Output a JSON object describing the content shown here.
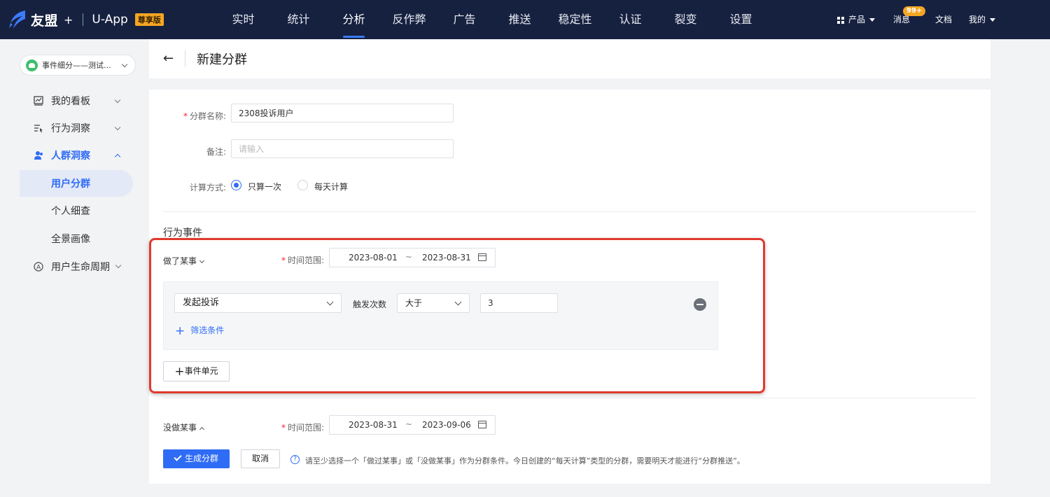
{
  "topbar": {
    "brand_name": "友盟",
    "brand_plus": "+",
    "brand_app": "U-App",
    "brand_badge": "尊享版",
    "nav": [
      "实时",
      "统计",
      "分析",
      "反作弊",
      "广告",
      "推送",
      "稳定性",
      "认证",
      "裂变",
      "设置"
    ],
    "nav_active_index": 2,
    "products_label": "产品",
    "messages_label": "消息",
    "messages_badge": "99+",
    "docs_label": "文档",
    "me_label": "我的"
  },
  "sidebar": {
    "app_name": "事件细分——测试...",
    "items": [
      {
        "label": "我的看板",
        "icon": "dashboard-icon"
      },
      {
        "label": "行为洞察",
        "icon": "behavior-icon"
      },
      {
        "label": "人群洞察",
        "icon": "people-icon"
      },
      {
        "label": "用户分群"
      },
      {
        "label": "个人细查"
      },
      {
        "label": "全景画像"
      },
      {
        "label": "用户生命周期",
        "icon": "lifecycle-icon"
      }
    ]
  },
  "header": {
    "title": "新建分群"
  },
  "form": {
    "name_label": "分群名称:",
    "name_value": "2308投诉用户",
    "note_label": "备注:",
    "note_placeholder": "请输入",
    "calc_label": "计算方式:",
    "calc_options": [
      "只算一次",
      "每天计算"
    ],
    "calc_selected": 0,
    "section_title": "行为事件",
    "did_group": {
      "mode": "做了某事",
      "time_label": "时间范围:",
      "date_start": "2023-08-01",
      "date_sep": "~",
      "date_end": "2023-08-31",
      "event_name": "发起投诉",
      "trigger_label": "触发次数",
      "operator": "大于",
      "count": "3",
      "filter_label": "筛选条件",
      "add_unit_label": "事件单元"
    },
    "not_did_group": {
      "mode": "没做某事",
      "time_label": "时间范围:",
      "date_start": "2023-08-31",
      "date_sep": "~",
      "date_end": "2023-09-06"
    },
    "submit_label": "生成分群",
    "cancel_label": "取消",
    "hint": "请至少选择一个「做过某事」或「没做某事」作为分群条件。今日创建的“每天计算”类型的分群，需要明天才能进行“分群推送”。"
  },
  "colors": {
    "nav_bg": "#162140",
    "accent": "#2f6cf5",
    "badge": "#f5a623",
    "highlight": "#e03a2e"
  }
}
